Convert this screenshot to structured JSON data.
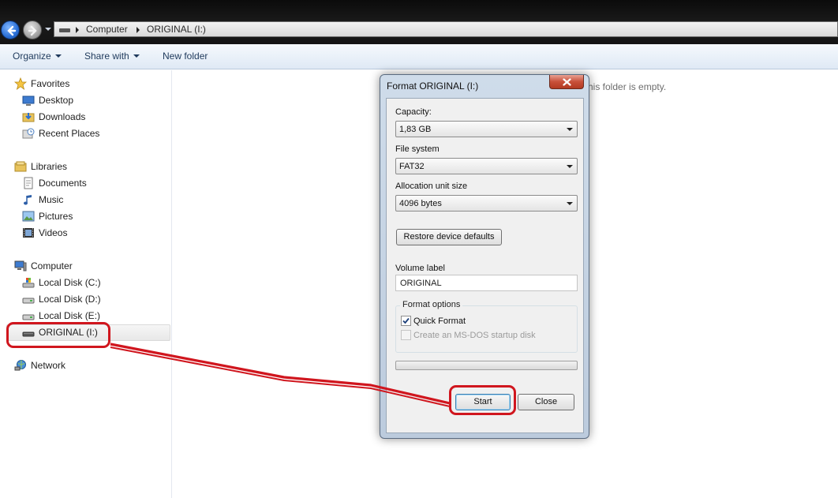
{
  "address_bar": {
    "crumbs": [
      "Computer",
      "ORIGINAL (I:)"
    ]
  },
  "toolbar": {
    "organize": "Organize",
    "share_with": "Share with",
    "new_folder": "New folder"
  },
  "nav": {
    "favorites": "Favorites",
    "desktop": "Desktop",
    "downloads": "Downloads",
    "recent_places": "Recent Places",
    "libraries": "Libraries",
    "documents": "Documents",
    "music": "Music",
    "pictures": "Pictures",
    "videos": "Videos",
    "computer": "Computer",
    "disk_c": "Local Disk (C:)",
    "disk_d": "Local Disk (D:)",
    "disk_e": "Local Disk (E:)",
    "drive_i": "ORIGINAL (I:)",
    "network": "Network"
  },
  "content": {
    "empty_message": "his folder is empty."
  },
  "dialog": {
    "title": "Format ORIGINAL (I:)",
    "capacity_label": "Capacity:",
    "capacity_value": "1,83 GB",
    "filesystem_label": "File system",
    "filesystem_value": "FAT32",
    "alloc_label": "Allocation unit size",
    "alloc_value": "4096 bytes",
    "restore_button": "Restore device defaults",
    "volume_label": "Volume label",
    "volume_value": "ORIGINAL",
    "format_options": "Format options",
    "quick_format": "Quick Format",
    "quick_format_checked": true,
    "msdos_disk": "Create an MS-DOS startup disk",
    "msdos_checked": false,
    "progress": 0,
    "start_button": "Start",
    "close_button": "Close"
  },
  "colors": {
    "annotation": "#d0161e",
    "toolbar_text": "#1e395b",
    "dialog_frame": "#bccbdd"
  }
}
